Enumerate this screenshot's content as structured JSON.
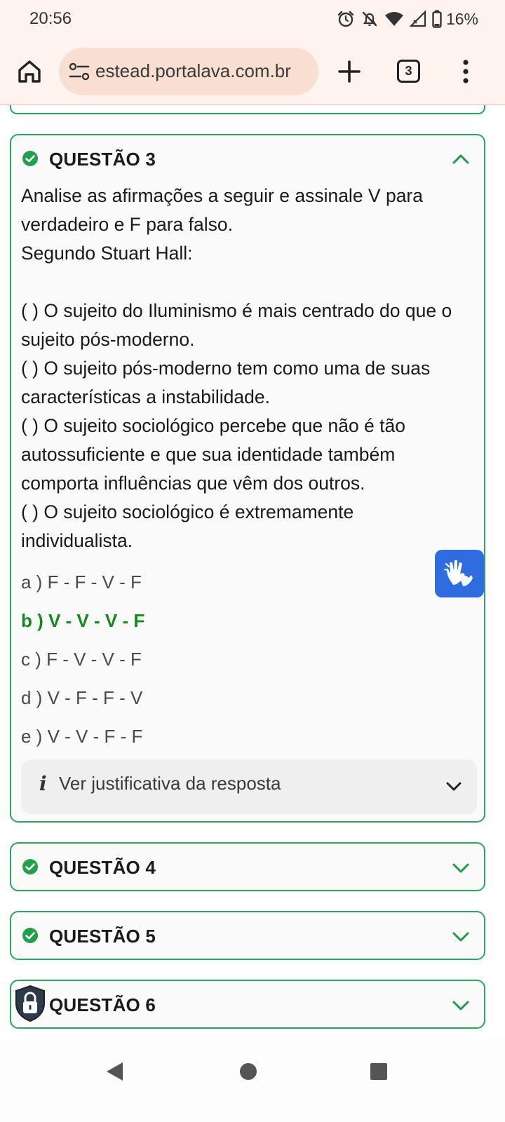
{
  "status_bar": {
    "time": "20:56",
    "battery": "16%",
    "icons": [
      "alarm-icon",
      "notifications-off-icon",
      "wifi-icon",
      "signal-icon",
      "battery-icon"
    ]
  },
  "browser": {
    "url": "estead.portalava.com.br",
    "tab_count": "3",
    "icons": [
      "home-icon",
      "site-info-icon",
      "plus-icon",
      "tabs-icon",
      "more-menu-icon"
    ]
  },
  "question3": {
    "title": "QUESTÃO 3",
    "expanded": true,
    "status": "answered",
    "text_lines": [
      "Analise as afirmações a seguir e assinale V para",
      "verdadeiro e F para falso.",
      "Segundo Stuart Hall:",
      "",
      "( ) O sujeito do Iluminismo é mais centrado do que o",
      "sujeito pós-moderno.",
      "( ) O sujeito pós-moderno tem como uma de suas",
      "características a instabilidade.",
      "( ) O sujeito sociológico percebe que não é tão",
      "autossuficiente e que sua identidade também",
      "comporta influências que vêm dos outros.",
      "( ) O sujeito sociológico é extremamente",
      "individualista."
    ],
    "options": [
      {
        "label": "a ) F - F - V - F",
        "correct": false
      },
      {
        "label": "b ) V - V - V - F",
        "correct": true
      },
      {
        "label": "c ) F - V - V - F",
        "correct": false
      },
      {
        "label": "d ) V - F - F - V",
        "correct": false
      },
      {
        "label": "e ) V - V - F - F",
        "correct": false
      }
    ],
    "justification_label": "Ver justificativa da resposta"
  },
  "question4": {
    "title": "QUESTÃO 4",
    "status": "answered",
    "expanded": false
  },
  "question5": {
    "title": "QUESTÃO 5",
    "status": "answered",
    "expanded": false
  },
  "question6": {
    "title": "QUESTÃO 6",
    "status": "locked",
    "expanded": false
  },
  "colors": {
    "accent_green": "#2aa55a",
    "correct_text": "#138a1e",
    "a11y_blue": "#2f6cdf",
    "browser_bar": "#fff3ee",
    "url_pill": "#f9dfd2"
  }
}
